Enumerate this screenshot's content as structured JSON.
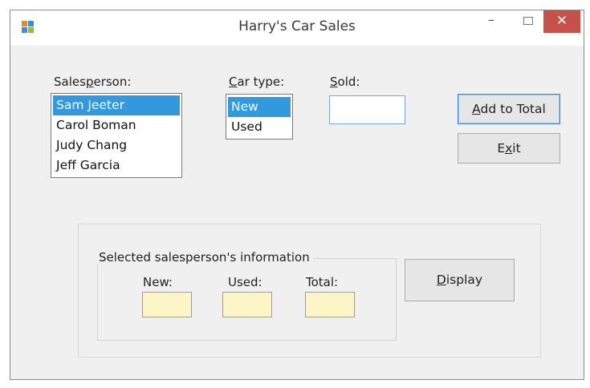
{
  "window": {
    "title": "Harry's Car Sales"
  },
  "titlebar_buttons": {
    "minimize": "–",
    "close": "✕"
  },
  "labels": {
    "salesperson": {
      "pre": "Sales",
      "key": "p",
      "post": "erson:"
    },
    "car_type": {
      "pre": "",
      "key": "C",
      "post": "ar type:"
    },
    "sold": {
      "pre": "",
      "key": "S",
      "post": "old:"
    }
  },
  "salesperson_list": {
    "items": [
      "Sam Jeeter",
      "Carol Boman",
      "Judy Chang",
      "Jeff Garcia"
    ],
    "selected": "Sam Jeeter"
  },
  "car_type_list": {
    "items": [
      "New",
      "Used"
    ],
    "selected": "New"
  },
  "sold_input": {
    "value": ""
  },
  "buttons": {
    "add_to_total": {
      "pre": "",
      "key": "A",
      "post": "dd to Total"
    },
    "exit": {
      "pre": "E",
      "key": "x",
      "post": "it"
    },
    "display": {
      "pre": "",
      "key": "D",
      "post": "isplay"
    }
  },
  "info_group": {
    "caption": "Selected salesperson's information",
    "new_label": "New:",
    "used_label": "Used:",
    "total_label": "Total:",
    "new_value": "",
    "used_value": "",
    "total_value": ""
  },
  "icons": {
    "app": "windows-form-icon",
    "minimize": "minimize-icon",
    "maximize": "maximize-icon",
    "close": "close-icon"
  },
  "colors": {
    "selection": "#3399df",
    "output_box": "#fef5c7",
    "close_button": "#c7504a",
    "form_background": "#f0f0f0"
  }
}
